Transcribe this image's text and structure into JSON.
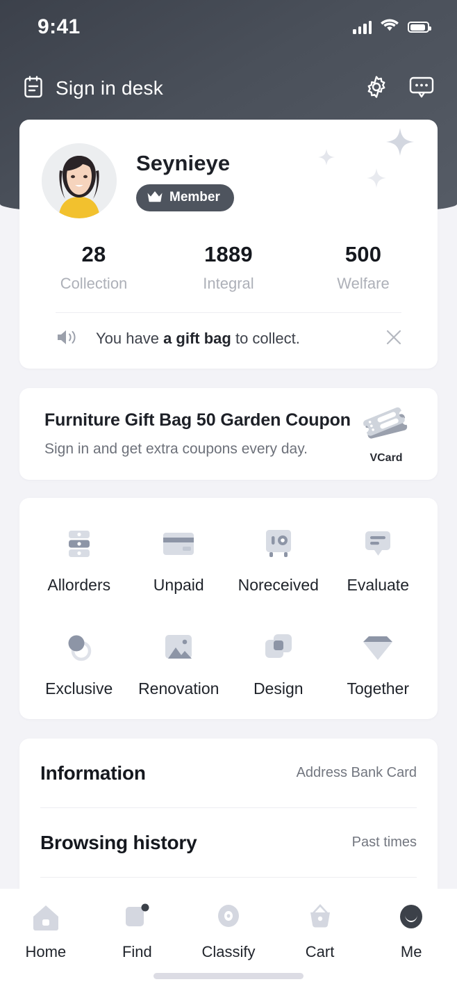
{
  "statusbar": {
    "time": "9:41",
    "signal_icon": "signal-bars-icon",
    "wifi_icon": "wifi-icon",
    "battery_icon": "battery-icon"
  },
  "navbar": {
    "title": "Sign in desk",
    "left_icon": "clipboard-icon",
    "settings_icon": "gear-icon",
    "message_icon": "message-bubble-icon"
  },
  "profile": {
    "avatar_icon": "avatar",
    "name": "Seynieye",
    "badge_label": "Member",
    "badge_icon": "crown-icon",
    "stats": [
      {
        "value": "28",
        "label": "Collection"
      },
      {
        "value": "1889",
        "label": "Integral"
      },
      {
        "value": "500",
        "label": "Welfare"
      }
    ],
    "notice": {
      "icon": "speaker-icon",
      "prefix": "You have ",
      "highlight": "a gift bag",
      "suffix": " to collect.",
      "close_icon": "close-icon"
    }
  },
  "coupon": {
    "title": "Furniture Gift Bag 50 Garden Coupon",
    "subtitle": "Sign in and get extra coupons every day.",
    "icon": "ticket-icon",
    "icon_label": "VCard"
  },
  "grid": {
    "row1": [
      {
        "label": "Allorders",
        "icon": "orders-list-icon"
      },
      {
        "label": "Unpaid",
        "icon": "credit-card-icon"
      },
      {
        "label": "Noreceived",
        "icon": "safe-box-icon"
      },
      {
        "label": "Evaluate",
        "icon": "comment-icon"
      }
    ],
    "row2": [
      {
        "label": "Exclusive",
        "icon": "circles-icon"
      },
      {
        "label": "Renovation",
        "icon": "image-icon"
      },
      {
        "label": "Design",
        "icon": "layers-icon"
      },
      {
        "label": "Together",
        "icon": "diamond-icon"
      }
    ]
  },
  "list": [
    {
      "title": "Information",
      "meta": "Address Bank Card"
    },
    {
      "title": "Browsing history",
      "meta": "Past times"
    }
  ],
  "tabbar": [
    {
      "label": "Home",
      "icon": "home-icon",
      "active": false,
      "badge": false
    },
    {
      "label": "Find",
      "icon": "find-icon",
      "active": false,
      "badge": true
    },
    {
      "label": "Classify",
      "icon": "classify-icon",
      "active": false,
      "badge": false
    },
    {
      "label": "Cart",
      "icon": "cart-icon",
      "active": false,
      "badge": false
    },
    {
      "label": "Me",
      "icon": "me-icon",
      "active": true,
      "badge": false
    }
  ],
  "colors": {
    "header": "#4a505a",
    "page_background": "#f3f3f7",
    "card": "#ffffff",
    "text_primary": "#15181e",
    "text_muted": "#adb0b8",
    "icon_light": "#d4d7e0",
    "icon_dark": "#8a92a3"
  }
}
